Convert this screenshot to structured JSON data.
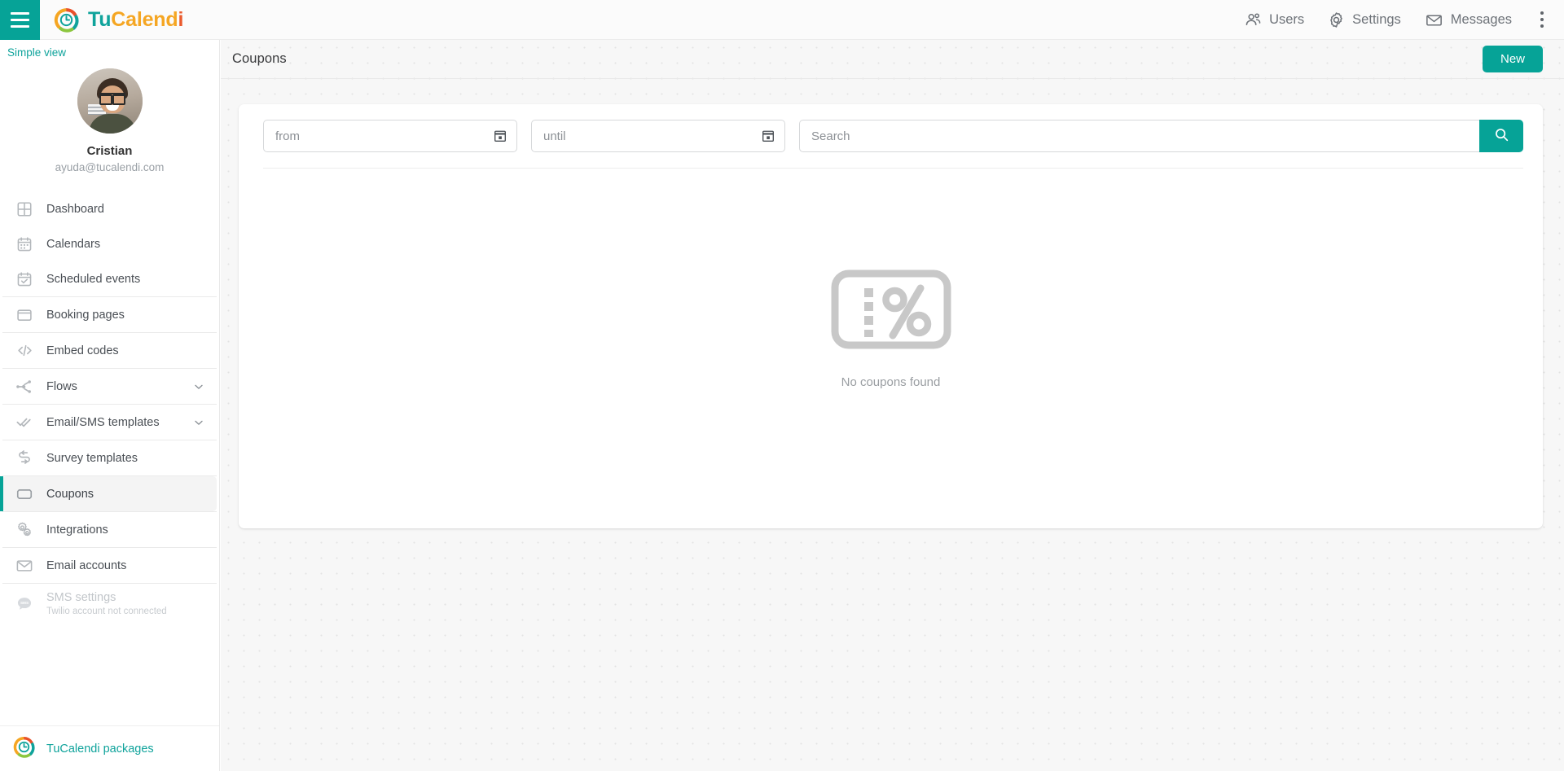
{
  "topbar": {
    "menu_icon": "hamburger-icon",
    "brand": {
      "part1": "Tu",
      "part2": "Calend",
      "part3": "i",
      "logo_icon": "tucalendi-logo-icon"
    },
    "actions": [
      {
        "label": "Users",
        "icon": "users-icon"
      },
      {
        "label": "Settings",
        "icon": "gear-icon"
      },
      {
        "label": "Messages",
        "icon": "envelope-icon"
      }
    ],
    "overflow_icon": "kebab-menu-icon",
    "accent_color": "#06a397"
  },
  "sidebar": {
    "simple_view": "Simple view",
    "profile": {
      "name": "Cristian",
      "email": "ayuda@tucalendi.com",
      "avatar_icon": "user-avatar"
    },
    "items": [
      {
        "label": "Dashboard",
        "icon": "dashboard-grid-icon",
        "active": false,
        "chevron": false,
        "sub": "",
        "disabled": false
      },
      {
        "label": "Calendars",
        "icon": "calendar-icon",
        "active": false,
        "chevron": false,
        "sub": "",
        "disabled": false
      },
      {
        "label": "Scheduled events",
        "icon": "calendar-check-icon",
        "active": false,
        "chevron": false,
        "sub": "",
        "disabled": false
      },
      {
        "label": "Booking pages",
        "icon": "window-icon",
        "active": false,
        "chevron": false,
        "sub": "",
        "disabled": false
      },
      {
        "label": "Embed codes",
        "icon": "code-brackets-icon",
        "active": false,
        "chevron": false,
        "sub": "",
        "disabled": false
      },
      {
        "label": "Flows",
        "icon": "flow-nodes-icon",
        "active": false,
        "chevron": true,
        "sub": "",
        "disabled": false
      },
      {
        "label": "Email/SMS templates",
        "icon": "double-check-icon",
        "active": false,
        "chevron": true,
        "sub": "",
        "disabled": false
      },
      {
        "label": "Survey templates",
        "icon": "survey-arrows-icon",
        "active": false,
        "chevron": false,
        "sub": "",
        "disabled": false
      },
      {
        "label": "Coupons",
        "icon": "ticket-icon",
        "active": true,
        "chevron": false,
        "sub": "",
        "disabled": false
      },
      {
        "label": "Integrations",
        "icon": "gears-icon",
        "active": false,
        "chevron": false,
        "sub": "",
        "disabled": false
      },
      {
        "label": "Email accounts",
        "icon": "envelope-icon",
        "active": false,
        "chevron": false,
        "sub": "",
        "disabled": false
      },
      {
        "label": "SMS settings",
        "icon": "sms-bubble-icon",
        "active": false,
        "chevron": false,
        "sub": "Twilio account not connected",
        "disabled": true
      }
    ],
    "footer": {
      "label": "TuCalendi packages",
      "icon": "tucalendi-logo-icon"
    }
  },
  "main": {
    "title": "Coupons",
    "new_button": "New",
    "filters": {
      "from_placeholder": "from",
      "from_value": "",
      "until_placeholder": "until",
      "until_value": "",
      "search_placeholder": "Search",
      "search_value": "",
      "search_button_icon": "search-icon",
      "date_picker_icon": "calendar-picker-icon"
    },
    "empty": {
      "icon": "coupon-percent-icon",
      "message": "No coupons found"
    }
  }
}
